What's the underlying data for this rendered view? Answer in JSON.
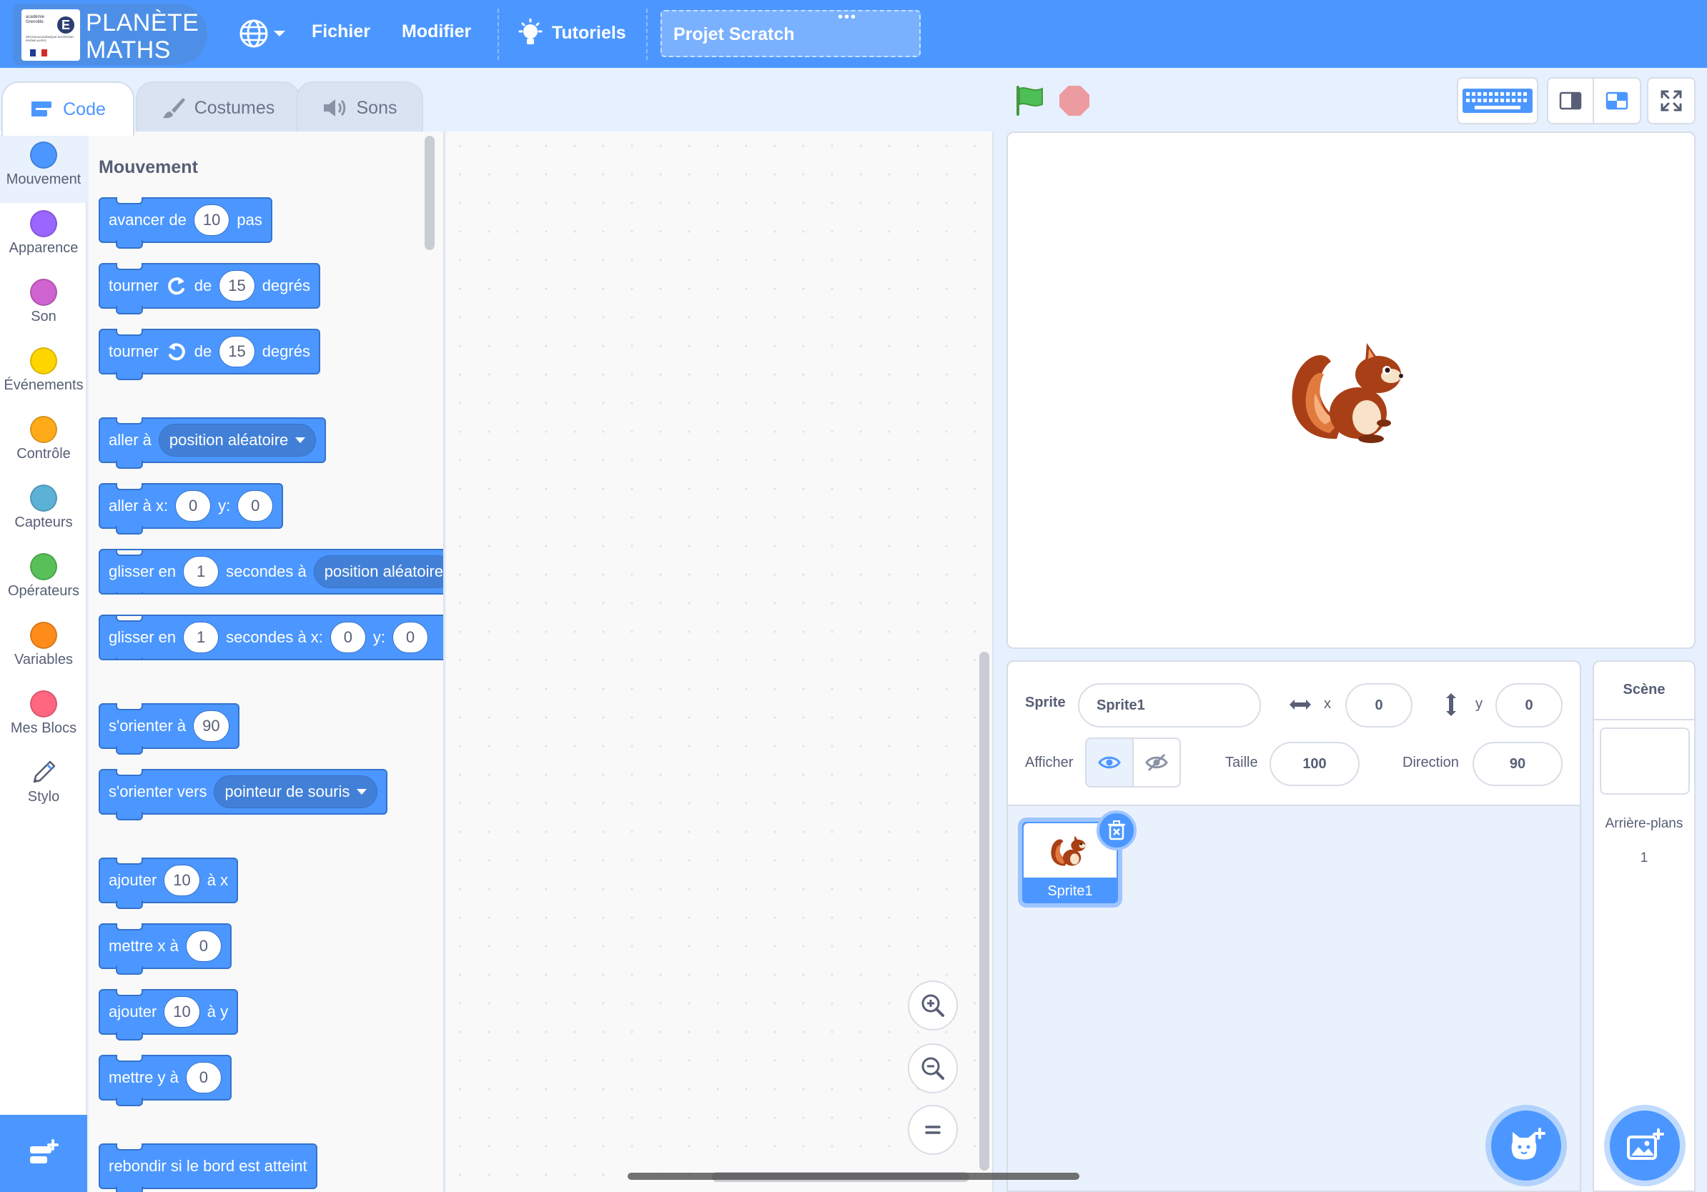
{
  "menubar": {
    "logo": {
      "line1": "PLANÈTE",
      "line2": "MATHS",
      "badge_text": "académie Grenoble",
      "badge_sub": "RÉGION ACADÉMIQUE AUVERGNE-RHÔNE-ALPES"
    },
    "language_icon": "globe-icon",
    "file_label": "Fichier",
    "edit_label": "Modifier",
    "tutorials_label": "Tutoriels",
    "project_title": "Projet Scratch",
    "project_menu_icon": "ellipsis-icon"
  },
  "tabs": {
    "code": "Code",
    "costumes": "Costumes",
    "sounds": "Sons"
  },
  "categories": [
    {
      "label": "Mouvement",
      "color": "#4c97ff"
    },
    {
      "label": "Apparence",
      "color": "#9966ff"
    },
    {
      "label": "Son",
      "color": "#cf63cf"
    },
    {
      "label": "Événements",
      "color": "#ffd500"
    },
    {
      "label": "Contrôle",
      "color": "#ffab19"
    },
    {
      "label": "Capteurs",
      "color": "#5cb1d6"
    },
    {
      "label": "Opérateurs",
      "color": "#59c059"
    },
    {
      "label": "Variables",
      "color": "#ff8c1a"
    },
    {
      "label": "Mes Blocs",
      "color": "#ff6680"
    },
    {
      "label": "Stylo",
      "color": "pen-icon"
    }
  ],
  "palette": {
    "heading": "Mouvement",
    "blocks": {
      "move": {
        "a": "avancer de",
        "v": "10",
        "b": "pas"
      },
      "turn_right": {
        "a": "tourner",
        "b": "de",
        "v": "15",
        "c": "degrés"
      },
      "turn_left": {
        "a": "tourner",
        "b": "de",
        "v": "15",
        "c": "degrés"
      },
      "goto": {
        "a": "aller à",
        "menu": "position aléatoire"
      },
      "goto_xy": {
        "a": "aller à x:",
        "x": "0",
        "b": "y:",
        "y": "0"
      },
      "glide": {
        "a": "glisser en",
        "v": "1",
        "b": "secondes à",
        "menu": "position aléatoire"
      },
      "glide_xy": {
        "a": "glisser en",
        "v": "1",
        "b": "secondes à x:",
        "x": "0",
        "c": "y:",
        "y": "0"
      },
      "point": {
        "a": "s'orienter à",
        "v": "90"
      },
      "point_towards": {
        "a": "s'orienter vers",
        "menu": "pointeur de souris"
      },
      "change_x": {
        "a": "ajouter",
        "v": "10",
        "b": "à x"
      },
      "set_x": {
        "a": "mettre x à",
        "v": "0"
      },
      "change_y": {
        "a": "ajouter",
        "v": "10",
        "b": "à y"
      },
      "set_y": {
        "a": "mettre y à",
        "v": "0"
      },
      "bounce": {
        "a": "rebondir si le bord est atteint"
      }
    }
  },
  "sprite_info": {
    "sprite_label": "Sprite",
    "sprite_name": "Sprite1",
    "x_label": "x",
    "x_value": "0",
    "y_label": "y",
    "y_value": "0",
    "show_label": "Afficher",
    "size_label": "Taille",
    "size_value": "100",
    "direction_label": "Direction",
    "direction_value": "90"
  },
  "sprites": [
    {
      "name": "Sprite1",
      "icon": "squirrel-icon"
    }
  ],
  "scene": {
    "title": "Scène",
    "backdrops_label": "Arrière-plans",
    "backdrops_count": "1"
  },
  "colors": {
    "accent": "#4c97ff",
    "motion_block": "#4c97ff",
    "motion_block_border": "#3373cc",
    "green_flag": "#4cbf56",
    "stop": "#ec9ca0"
  }
}
